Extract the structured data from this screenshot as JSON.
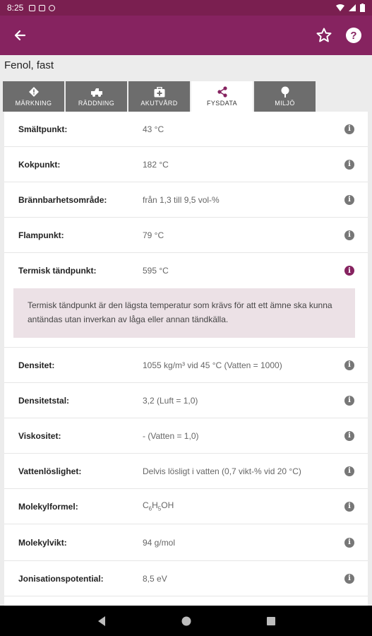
{
  "status": {
    "time": "8:25"
  },
  "appbar": {
    "back_icon": "arrow-left-icon",
    "favorite_icon": "star-outline-icon",
    "help_icon": "help-circle-icon"
  },
  "page_title": "Fenol, fast",
  "tabs": [
    {
      "label": "MÄRKNING",
      "icon": "warning-diamond-icon"
    },
    {
      "label": "RÄDDNING",
      "icon": "fire-truck-icon"
    },
    {
      "label": "AKUTVÅRD",
      "icon": "first-aid-kit-icon"
    },
    {
      "label": "FYSDATA",
      "icon": "molecule-icon"
    },
    {
      "label": "MILJÖ",
      "icon": "tree-icon"
    }
  ],
  "active_tab": "FYSDATA",
  "rows": [
    {
      "label": "Smältpunkt:",
      "value": "43 °C"
    },
    {
      "label": "Kokpunkt:",
      "value": "182 °C"
    },
    {
      "label": "Brännbarhetsområde:",
      "value": "från 1,3 till 9,5 vol-%"
    },
    {
      "label": "Flampunkt:",
      "value": "79 °C"
    },
    {
      "label": "Termisk tändpunkt:",
      "value": "595 °C",
      "expanded": true
    },
    {
      "label": "Densitet:",
      "value": "1055 kg/m³ vid 45 °C  (Vatten = 1000)"
    },
    {
      "label": "Densitetstal:",
      "value": "3,2  (Luft = 1,0)"
    },
    {
      "label": "Viskositet:",
      "value": "-  (Vatten = 1,0)"
    },
    {
      "label": "Vattenlöslighet:",
      "value": "Delvis lösligt i vatten (0,7 vikt-% vid 20 °C)"
    },
    {
      "label": "Molekylformel:",
      "value_parts": [
        "C",
        "6",
        "H",
        "5",
        "OH"
      ]
    },
    {
      "label": "Molekylvikt:",
      "value": "94 g/mol"
    },
    {
      "label": "Jonisationspotential:",
      "value": "8,5 eV"
    }
  ],
  "explanation": "Termisk tändpunkt är den lägsta temperatur som krävs för att ett ämne ska kunna antändas utan inverkan av låga eller annan tändkälla.",
  "colors": {
    "brand": "#862360",
    "tab_inactive": "#6d6d6d",
    "explanation_bg": "#ece1e6"
  }
}
